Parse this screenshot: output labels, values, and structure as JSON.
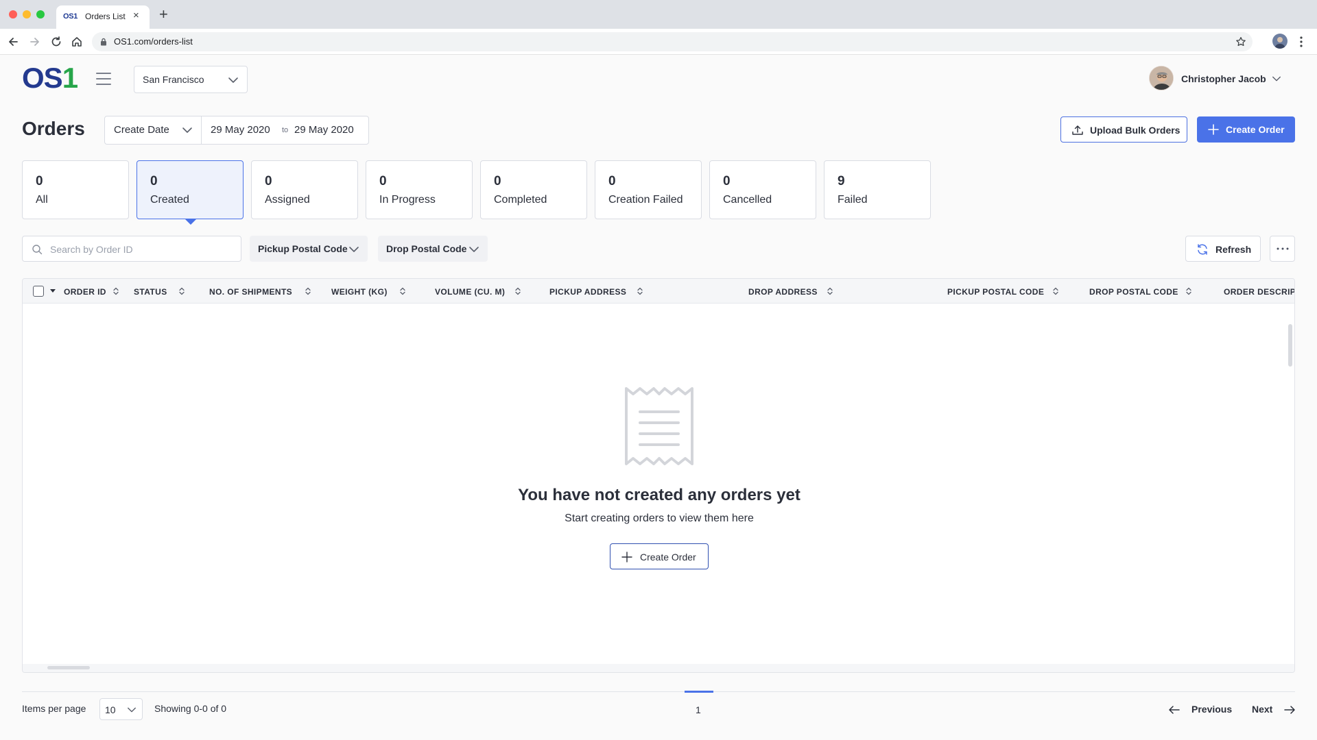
{
  "browser": {
    "tab_logo": "OS1",
    "tab_title": "Orders List",
    "url": "OS1.com/orders-list"
  },
  "header": {
    "logo_main": "OS",
    "logo_accent": "1",
    "city": "San Francisco",
    "user_name": "Christopher Jacob"
  },
  "page": {
    "title": "Orders",
    "date_filter": {
      "type": "Create Date",
      "from": "29 May 2020",
      "separator": "to",
      "until": "29 May 2020"
    },
    "upload_label": "Upload Bulk Orders",
    "create_label": "Create Order"
  },
  "status_cards": [
    {
      "count": "0",
      "label": "All"
    },
    {
      "count": "0",
      "label": "Created",
      "active": true
    },
    {
      "count": "0",
      "label": "Assigned"
    },
    {
      "count": "0",
      "label": "In Progress"
    },
    {
      "count": "0",
      "label": "Completed"
    },
    {
      "count": "0",
      "label": "Creation Failed"
    },
    {
      "count": "0",
      "label": "Cancelled"
    },
    {
      "count": "9",
      "label": "Failed"
    }
  ],
  "filters": {
    "search_placeholder": "Search by Order ID",
    "pickup_postal": "Pickup Postal Code",
    "drop_postal": "Drop Postal Code",
    "refresh_label": "Refresh"
  },
  "table": {
    "columns": [
      "ORDER ID",
      "STATUS",
      "NO. OF SHIPMENTS",
      "WEIGHT (KG)",
      "VOLUME (CU. M)",
      "PICKUP ADDRESS",
      "DROP ADDRESS",
      "PICKUP POSTAL CODE",
      "DROP POSTAL CODE",
      "ORDER DESCRIPT"
    ],
    "empty_title": "You have not created any orders yet",
    "empty_subtitle": "Start creating orders to view them here",
    "empty_button": "Create Order"
  },
  "pagination": {
    "items_per_page_label": "Items per page",
    "items_per_page": "10",
    "showing": "Showing 0-0 of 0",
    "current_page": "1",
    "previous": "Previous",
    "next": "Next"
  },
  "colors": {
    "brand_blue": "#243a8f",
    "brand_green": "#27a54a",
    "accent": "#4a72e8"
  }
}
